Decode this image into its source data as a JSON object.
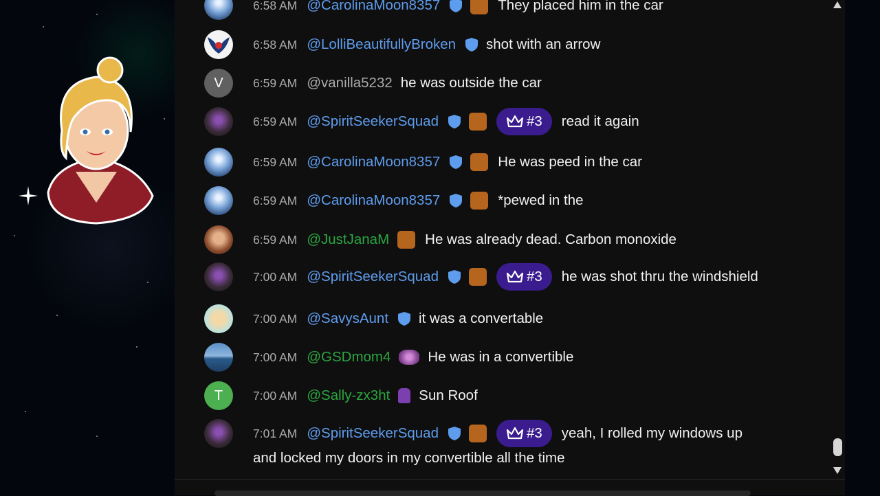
{
  "colors": {
    "chat_bg": "#0f0f0f",
    "moderator_name": "#5e9ced",
    "member_name": "#2ba640",
    "plain_name": "#aaaaaa",
    "rank_badge": "#3b1c8f"
  },
  "messages": [
    {
      "time": "6:58 AM",
      "author": "@CarolinaMoon8357",
      "name_style": "mod",
      "moderator": true,
      "member_badge": true,
      "rank": "",
      "text": "They placed him in the car",
      "avatar": "orb"
    },
    {
      "time": "6:58 AM",
      "author": "@LolliBeautifullyBroken",
      "name_style": "mod",
      "moderator": true,
      "member_badge": false,
      "rank": "",
      "text": "shot with an arrow",
      "avatar": "wings"
    },
    {
      "time": "6:59 AM",
      "author": "@vanilla5232",
      "name_style": "gry",
      "moderator": false,
      "member_badge": false,
      "rank": "",
      "text": "he was outside the car",
      "avatar": "letter-v"
    },
    {
      "time": "6:59 AM",
      "author": "@SpiritSeekerSquad",
      "name_style": "mod",
      "moderator": true,
      "member_badge": true,
      "rank": "#3",
      "text": "read it again",
      "avatar": "spirit"
    },
    {
      "time": "6:59 AM",
      "author": "@CarolinaMoon8357",
      "name_style": "mod",
      "moderator": true,
      "member_badge": true,
      "rank": "",
      "text": "He was peed in the car",
      "avatar": "orb"
    },
    {
      "time": "6:59 AM",
      "author": "@CarolinaMoon8357",
      "name_style": "mod",
      "moderator": true,
      "member_badge": true,
      "rank": "",
      "text": "*pewed in the",
      "avatar": "orb"
    },
    {
      "time": "6:59 AM",
      "author": "@JustJanaM",
      "name_style": "grn",
      "moderator": false,
      "member_badge": true,
      "rank": "",
      "text": "He was already dead. Carbon monoxide",
      "avatar": "woman"
    },
    {
      "time": "7:00 AM",
      "author": "@SpiritSeekerSquad",
      "name_style": "mod",
      "moderator": true,
      "member_badge": true,
      "rank": "#3",
      "text": "he was shot thru the windshield",
      "avatar": "spirit"
    },
    {
      "time": "7:00 AM",
      "author": "@SavysAunt",
      "name_style": "mod",
      "moderator": true,
      "member_badge": false,
      "rank": "",
      "text": "it was a convertable",
      "avatar": "bear"
    },
    {
      "time": "7:00 AM",
      "author": "@GSDmom4",
      "name_style": "grn",
      "moderator": false,
      "member_badge": true,
      "rank": "",
      "text": "He was in a convertible",
      "avatar": "sea"
    },
    {
      "time": "7:00 AM",
      "author": "@Sally-zx3ht",
      "name_style": "grn",
      "moderator": false,
      "member_badge": true,
      "rank": "",
      "text": "Sun Roof",
      "avatar": "letter-t"
    },
    {
      "time": "7:01 AM",
      "author": "@SpiritSeekerSquad",
      "name_style": "mod",
      "moderator": true,
      "member_badge": true,
      "rank": "#3",
      "text": "yeah, I rolled my windows up",
      "text_line2": "and locked my doors in my convertible all the time",
      "avatar": "spirit"
    }
  ],
  "avatar_letters": {
    "v": "V",
    "t": "T"
  },
  "icons": {
    "moderator": "shield-icon",
    "rank": "crown-icon",
    "scroll_up": "triangle-up-icon",
    "scroll_down": "triangle-down-icon",
    "cursor": "sparkle-cursor-icon"
  }
}
